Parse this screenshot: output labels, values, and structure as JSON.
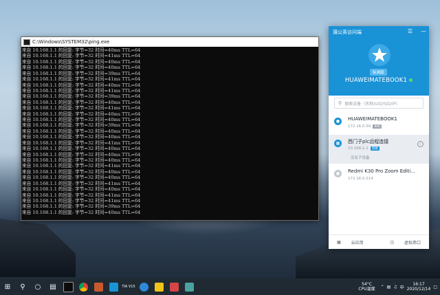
{
  "cmd": {
    "title": "C:\\Windows\\SYSTEM32\\ping.exe",
    "lines": [
      "来自 10.168.1.1 的回复: 字节=32 时间=40ms TTL=64",
      "来自 10.168.1.1 的回复: 字节=32 时间=41ms TTL=64",
      "来自 10.168.1.1 的回复: 字节=32 时间=40ms TTL=64",
      "来自 10.168.1.1 的回复: 字节=32 时间=40ms TTL=64",
      "来自 10.168.1.1 的回复: 字节=32 时间=39ms TTL=64",
      "来自 10.168.1.1 的回复: 字节=32 时间=41ms TTL=64",
      "来自 10.168.1.1 的回复: 字节=32 时间=40ms TTL=64",
      "来自 10.168.1.1 的回复: 字节=32 时间=41ms TTL=64",
      "来自 10.168.1.1 的回复: 字节=32 时间=39ms TTL=64",
      "来自 10.168.1.1 的回复: 字节=32 时间=40ms TTL=64",
      "来自 10.168.1.1 的回复: 字节=32 时间=41ms TTL=64",
      "来自 10.168.1.1 的回复: 字节=32 时间=40ms TTL=64",
      "来自 10.168.1.1 的回复: 字节=32 时间=40ms TTL=64",
      "来自 10.168.1.1 的回复: 字节=32 时间=39ms TTL=64",
      "来自 10.168.1.1 的回复: 字节=32 时间=40ms TTL=64",
      "来自 10.168.1.1 的回复: 字节=32 时间=40ms TTL=64",
      "来自 10.168.1.1 的回复: 字节=32 时间=41ms TTL=64",
      "来自 10.168.1.1 的回复: 字节=32 时间=40ms TTL=64",
      "来自 10.168.1.1 的回复: 字节=32 时间=40ms TTL=64",
      "来自 10.168.1.1 的回复: 字节=32 时间=40ms TTL=64",
      "来自 10.168.1.1 的回复: 字节=32 时间=41ms TTL=64",
      "来自 10.168.1.1 的回复: 字节=32 时间=40ms TTL=64",
      "来自 10.168.1.1 的回复: 字节=32 时间=40ms TTL=64",
      "来自 10.168.1.1 的回复: 字节=32 时间=41ms TTL=64",
      "来自 10.168.1.1 的回复: 字节=32 时间=40ms TTL=64",
      "来自 10.168.1.1 的回复: 字节=32 时间=41ms TTL=64",
      "来自 10.168.1.1 的回复: 字节=32 时间=41ms TTL=64",
      "来自 10.168.1.1 的回复: 字节=32 时间=39ms TTL=64",
      "来自 10.168.1.1 的回复: 字节=32 时间=40ms TTL=64"
    ]
  },
  "vpn": {
    "title": "蒲公英访问端",
    "edition_badge": "标准版",
    "device_name": "HUAWEIMATEBOOK1",
    "search_placeholder": "搜索设备（名称/UID/SID/IP）",
    "devices": [
      {
        "name": "HUAWEIMATEBOOK1",
        "ip": "172.16.0.50",
        "tag": "本机",
        "tag_color": "#9aa3ad"
      },
      {
        "name": "西门子plc远程连接",
        "ip": "10.168.1.1",
        "tag": "旁路",
        "tag_color": "#1a92d6",
        "sub": "没有子设备"
      },
      {
        "name": "Redmi K30 Pro Zoom Editi...",
        "ip": "172.16.0.214",
        "tag": "",
        "tag_color": ""
      }
    ],
    "footer": {
      "cloud_app": "云应用",
      "virtual_serial": "虚拟串口"
    },
    "accent": "#1a92d6"
  },
  "taskbar": {
    "temperature": "54°C",
    "temp_label": "CPU温度",
    "ime": "中",
    "time": "16:17",
    "date": "2020/12/14",
    "apps": [
      "windows-icon",
      "search-icon",
      "cortana-icon",
      "task-view-icon",
      "terminal-icon",
      "chrome-icon",
      "photo-icon",
      "app-icon",
      "tia-portal-icon",
      "edge-icon",
      "explorer-icon",
      "paint-icon",
      "window-icon"
    ],
    "tia_label": "TIA\nV15"
  }
}
